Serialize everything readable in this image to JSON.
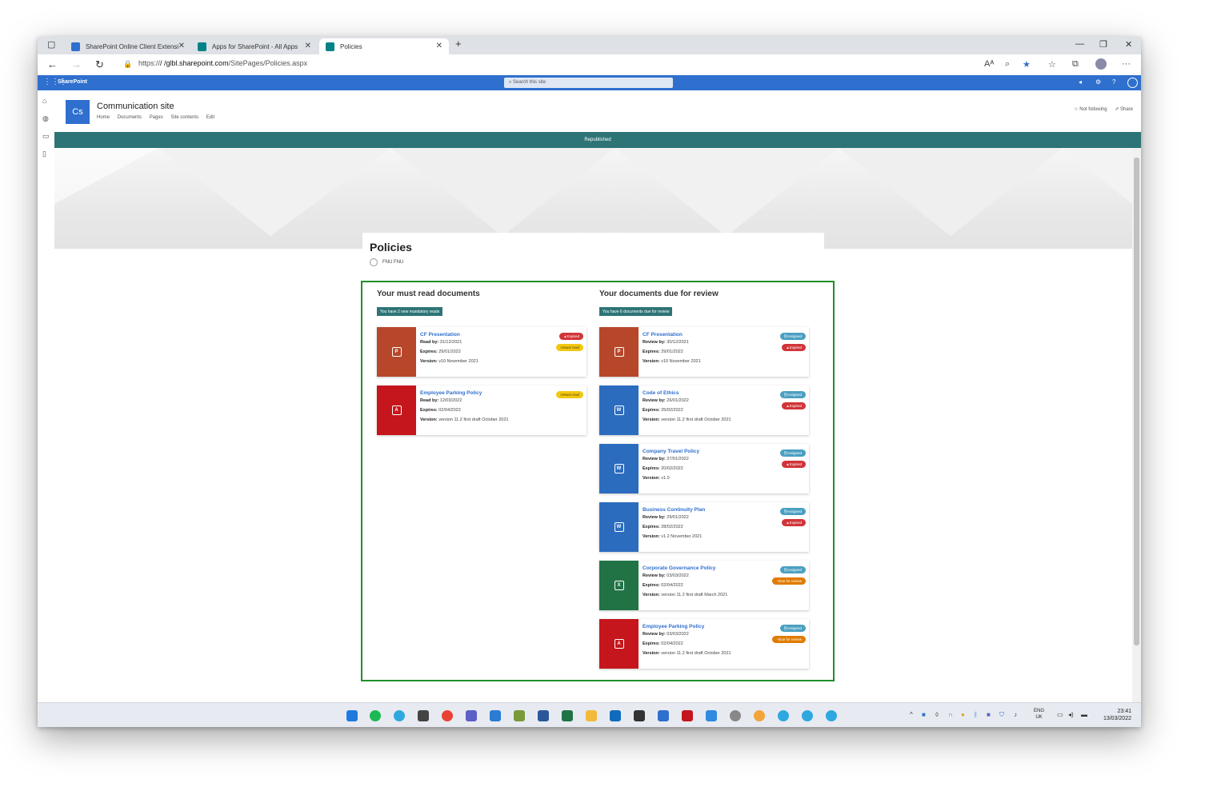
{
  "browser": {
    "tabs": [
      {
        "label": "SharePoint Online Client Extensi",
        "color": "#2f6fce"
      },
      {
        "label": "Apps for SharePoint - All Apps",
        "color": "#038387"
      },
      {
        "label": "Policies",
        "color": "#038387"
      }
    ],
    "new_tab": "+",
    "url_prefix": "https://",
    "url_host": "/ /glbl.sharepoint.com",
    "url_path": "/SitePages/Policies.aspx"
  },
  "suitebar": {
    "brand": "SharePoint",
    "search_placeholder": "Search this site"
  },
  "site": {
    "logo_text": "Cs",
    "title": "Communication site",
    "nav": [
      "Home",
      "Documents",
      "Pages",
      "Site contents",
      "Edit"
    ],
    "follow": "☆ Not following",
    "share": "⇗ Share",
    "status": "Republished"
  },
  "page": {
    "title": "Policies",
    "author": "FNU FNU"
  },
  "must_read": {
    "heading": "Your must read documents",
    "badge": "You have 2 new mandatory reads",
    "cards": [
      {
        "title": "CF Presentation",
        "date_label": "Read by:",
        "date": "31/12/2021",
        "expires": "29/01/2022",
        "version": "v10 November 2021",
        "type": "ppt",
        "color": "#b7472a",
        "pills": [
          "Expired",
          "Must read"
        ]
      },
      {
        "title": "Employee Parking Policy",
        "date_label": "Read by:",
        "date": "12/03/2022",
        "expires": "02/04/2022",
        "version": "version 11.2 first draft October 2021",
        "type": "pdf",
        "color": "#c4161c",
        "pills": [
          "Must read"
        ]
      }
    ]
  },
  "review": {
    "heading": "Your documents due for review",
    "badge": "You have 6 documents due for review",
    "cards": [
      {
        "title": "CF Presentation",
        "date_label": "Review by:",
        "date": "30/12/2021",
        "expires": "29/01/2022",
        "version": "v10 November 2021",
        "type": "ppt",
        "color": "#b7472a",
        "pills": [
          "Assigned",
          "Expired"
        ]
      },
      {
        "title": "Code of Ethics",
        "date_label": "Review by:",
        "date": "26/01/2022",
        "expires": "25/02/2022",
        "version": "version 11.2 first draft October 2021",
        "type": "word",
        "color": "#2b6cbf",
        "pills": [
          "Assigned",
          "Expired"
        ]
      },
      {
        "title": "Company Travel Policy",
        "date_label": "Review by:",
        "date": "27/01/2022",
        "expires": "20/02/2022",
        "version": "v1.0",
        "type": "word",
        "color": "#2b6cbf",
        "pills": [
          "Assigned",
          "Expired"
        ]
      },
      {
        "title": "Business Continuity Plan",
        "date_label": "Review by:",
        "date": "29/01/2022",
        "expires": "28/02/2022",
        "version": "v1.2 November 2021",
        "type": "word",
        "color": "#2b6cbf",
        "pills": [
          "Assigned",
          "Expired"
        ]
      },
      {
        "title": "Corporate Governance Policy",
        "date_label": "Review by:",
        "date": "03/03/2022",
        "expires": "02/04/2022",
        "version": "version 11.2 first draft March 2021",
        "type": "excel",
        "color": "#217346",
        "pills": [
          "Assigned",
          "Due for review"
        ]
      },
      {
        "title": "Employee Parking Policy",
        "date_label": "Review by:",
        "date": "03/03/2022",
        "expires": "02/04/2022",
        "version": "version 11.2 first draft October 2021",
        "type": "pdf",
        "color": "#c4161c",
        "pills": [
          "Assigned",
          "Due for review"
        ]
      }
    ]
  },
  "labels": {
    "expires": "Expires:",
    "version": "Version:"
  },
  "taskbar": {
    "lang_top": "ENG",
    "lang_bottom": "UK",
    "time": "23:41",
    "date": "13/03/2022"
  }
}
